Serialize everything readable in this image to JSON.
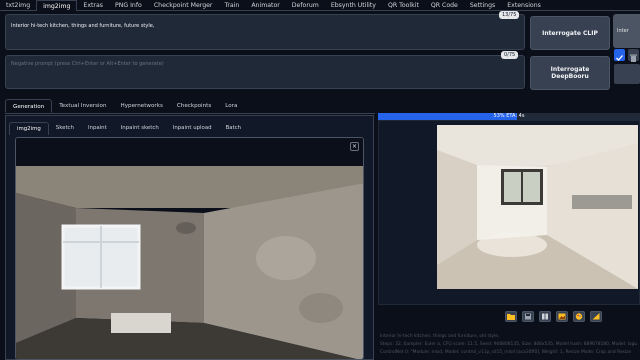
{
  "top_tabs": [
    "txt2img",
    "img2img",
    "Extras",
    "PNG Info",
    "Checkpoint Merger",
    "Train",
    "Animator",
    "Deforum",
    "Ebsynth Utility",
    "QR Toolkit",
    "QR Code",
    "Settings",
    "Extensions"
  ],
  "active_top_tab": "img2img",
  "prompt": {
    "value": "Interior hi-tech kitchen, things and furniture, future style,",
    "counter": "13/75"
  },
  "negative_prompt": {
    "placeholder": "Negative prompt (press Ctrl+Enter or Alt+Enter to generate)",
    "counter": "0/75"
  },
  "buttons": {
    "interrogate_clip": "Interrogate CLIP",
    "interrogate_deepbooru": "Interrogate DeepBooru",
    "generate": "Inter"
  },
  "sub_tabs": [
    "Generation",
    "Textual Inversion",
    "Hypernetworks",
    "Checkpoints",
    "Lora"
  ],
  "image_tabs": [
    "img2img",
    "Sketch",
    "Inpaint",
    "Inpaint sketch",
    "Inpaint upload",
    "Batch"
  ],
  "progress": {
    "label": "53% ETA: 4s",
    "fraction": 0.53
  },
  "close_glyph": "×",
  "tool_icons": [
    "folder-icon",
    "save-icon",
    "zip-icon",
    "image-icon",
    "palette-icon",
    "ruler-icon"
  ],
  "info_lines": [
    "Interior hi-tech kitchen, things and furniture, old style,",
    "Steps: 32, Sampler: Euler a, CFG scale: 11.5, Seed: 908808135, Size: 808x535, Model hash: 889678180, Model: lagu",
    "ControlNet 0: \"Module: mlsd, Model: control_v11p_sd15_mlsd [aca30ff0], Weight: 1, Resize Mode: Crop and Resize"
  ],
  "colors": {
    "accent": "#2563eb",
    "background": "#0b0f19"
  }
}
